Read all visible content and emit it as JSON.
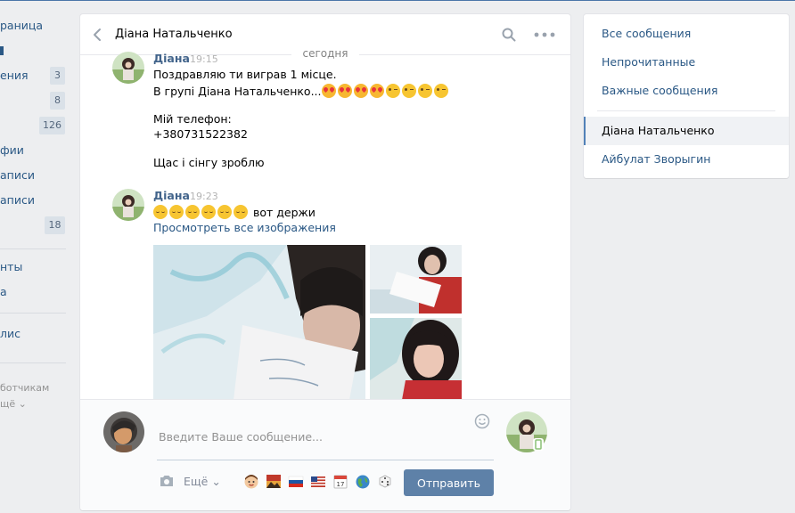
{
  "left_nav": {
    "items": [
      {
        "label": "раница",
        "count": ""
      },
      {
        "label": "",
        "count": ""
      },
      {
        "label": "ения",
        "count": "3"
      },
      {
        "label": "",
        "count": "8"
      },
      {
        "label": "",
        "count": "126"
      },
      {
        "label": "фии",
        "count": ""
      },
      {
        "label": "аписи",
        "count": ""
      },
      {
        "label": "аписи",
        "count": ""
      },
      {
        "label": "",
        "count": "18"
      },
      {
        "label": "нты",
        "count": ""
      },
      {
        "label": "а",
        "count": ""
      },
      {
        "label": "лис",
        "count": ""
      }
    ],
    "footer_link": "ботчикам",
    "footer_more": "щё"
  },
  "chat": {
    "title": "Діана Натальченко",
    "date_separator": "сегодня",
    "messages": [
      {
        "author": "Діана",
        "time": "19:15",
        "line1": "Поздравляю ти виграв 1 місце.",
        "line2": "В групі Діана Натальченко...",
        "line3": "Мій телефон:",
        "line4": "+380731522382",
        "line5": "Щас і сінгу зроблю"
      },
      {
        "author": "Діана",
        "time": "19:23",
        "text": "вот держи",
        "view_all_images": "Просмотреть все изображения"
      }
    ],
    "emoji_icons": {
      "first_message": [
        "smiling-face-heart-eyes",
        "smiling-face-heart-eyes",
        "smiling-face-heart-eyes",
        "smiling-face-heart-eyes",
        "winking-face",
        "winking-face",
        "winking-face",
        "winking-face"
      ],
      "second_message": [
        "relieved-face",
        "relieved-face",
        "relieved-face",
        "relieved-face",
        "relieved-face",
        "relieved-face"
      ]
    }
  },
  "composer": {
    "placeholder": "Введите Ваше сообщение...",
    "more_label": "Ещё",
    "send_label": "Отправить",
    "quick_emoji": [
      "boy-face",
      "sunset-landscape",
      "russia-flag",
      "usa-flag",
      "calendar",
      "globe",
      "game-die"
    ]
  },
  "filters": {
    "all": "Все сообщения",
    "unread": "Непрочитанные",
    "important": "Важные сообщения",
    "conversations": [
      "Діана Натальченко",
      "Айбулат Зворыгин"
    ]
  },
  "colors": {
    "link": "#2a5885",
    "author": "#42648b",
    "send_button": "#5e81a8",
    "active_filter_bar": "#5181b8",
    "background": "#edeef0"
  }
}
